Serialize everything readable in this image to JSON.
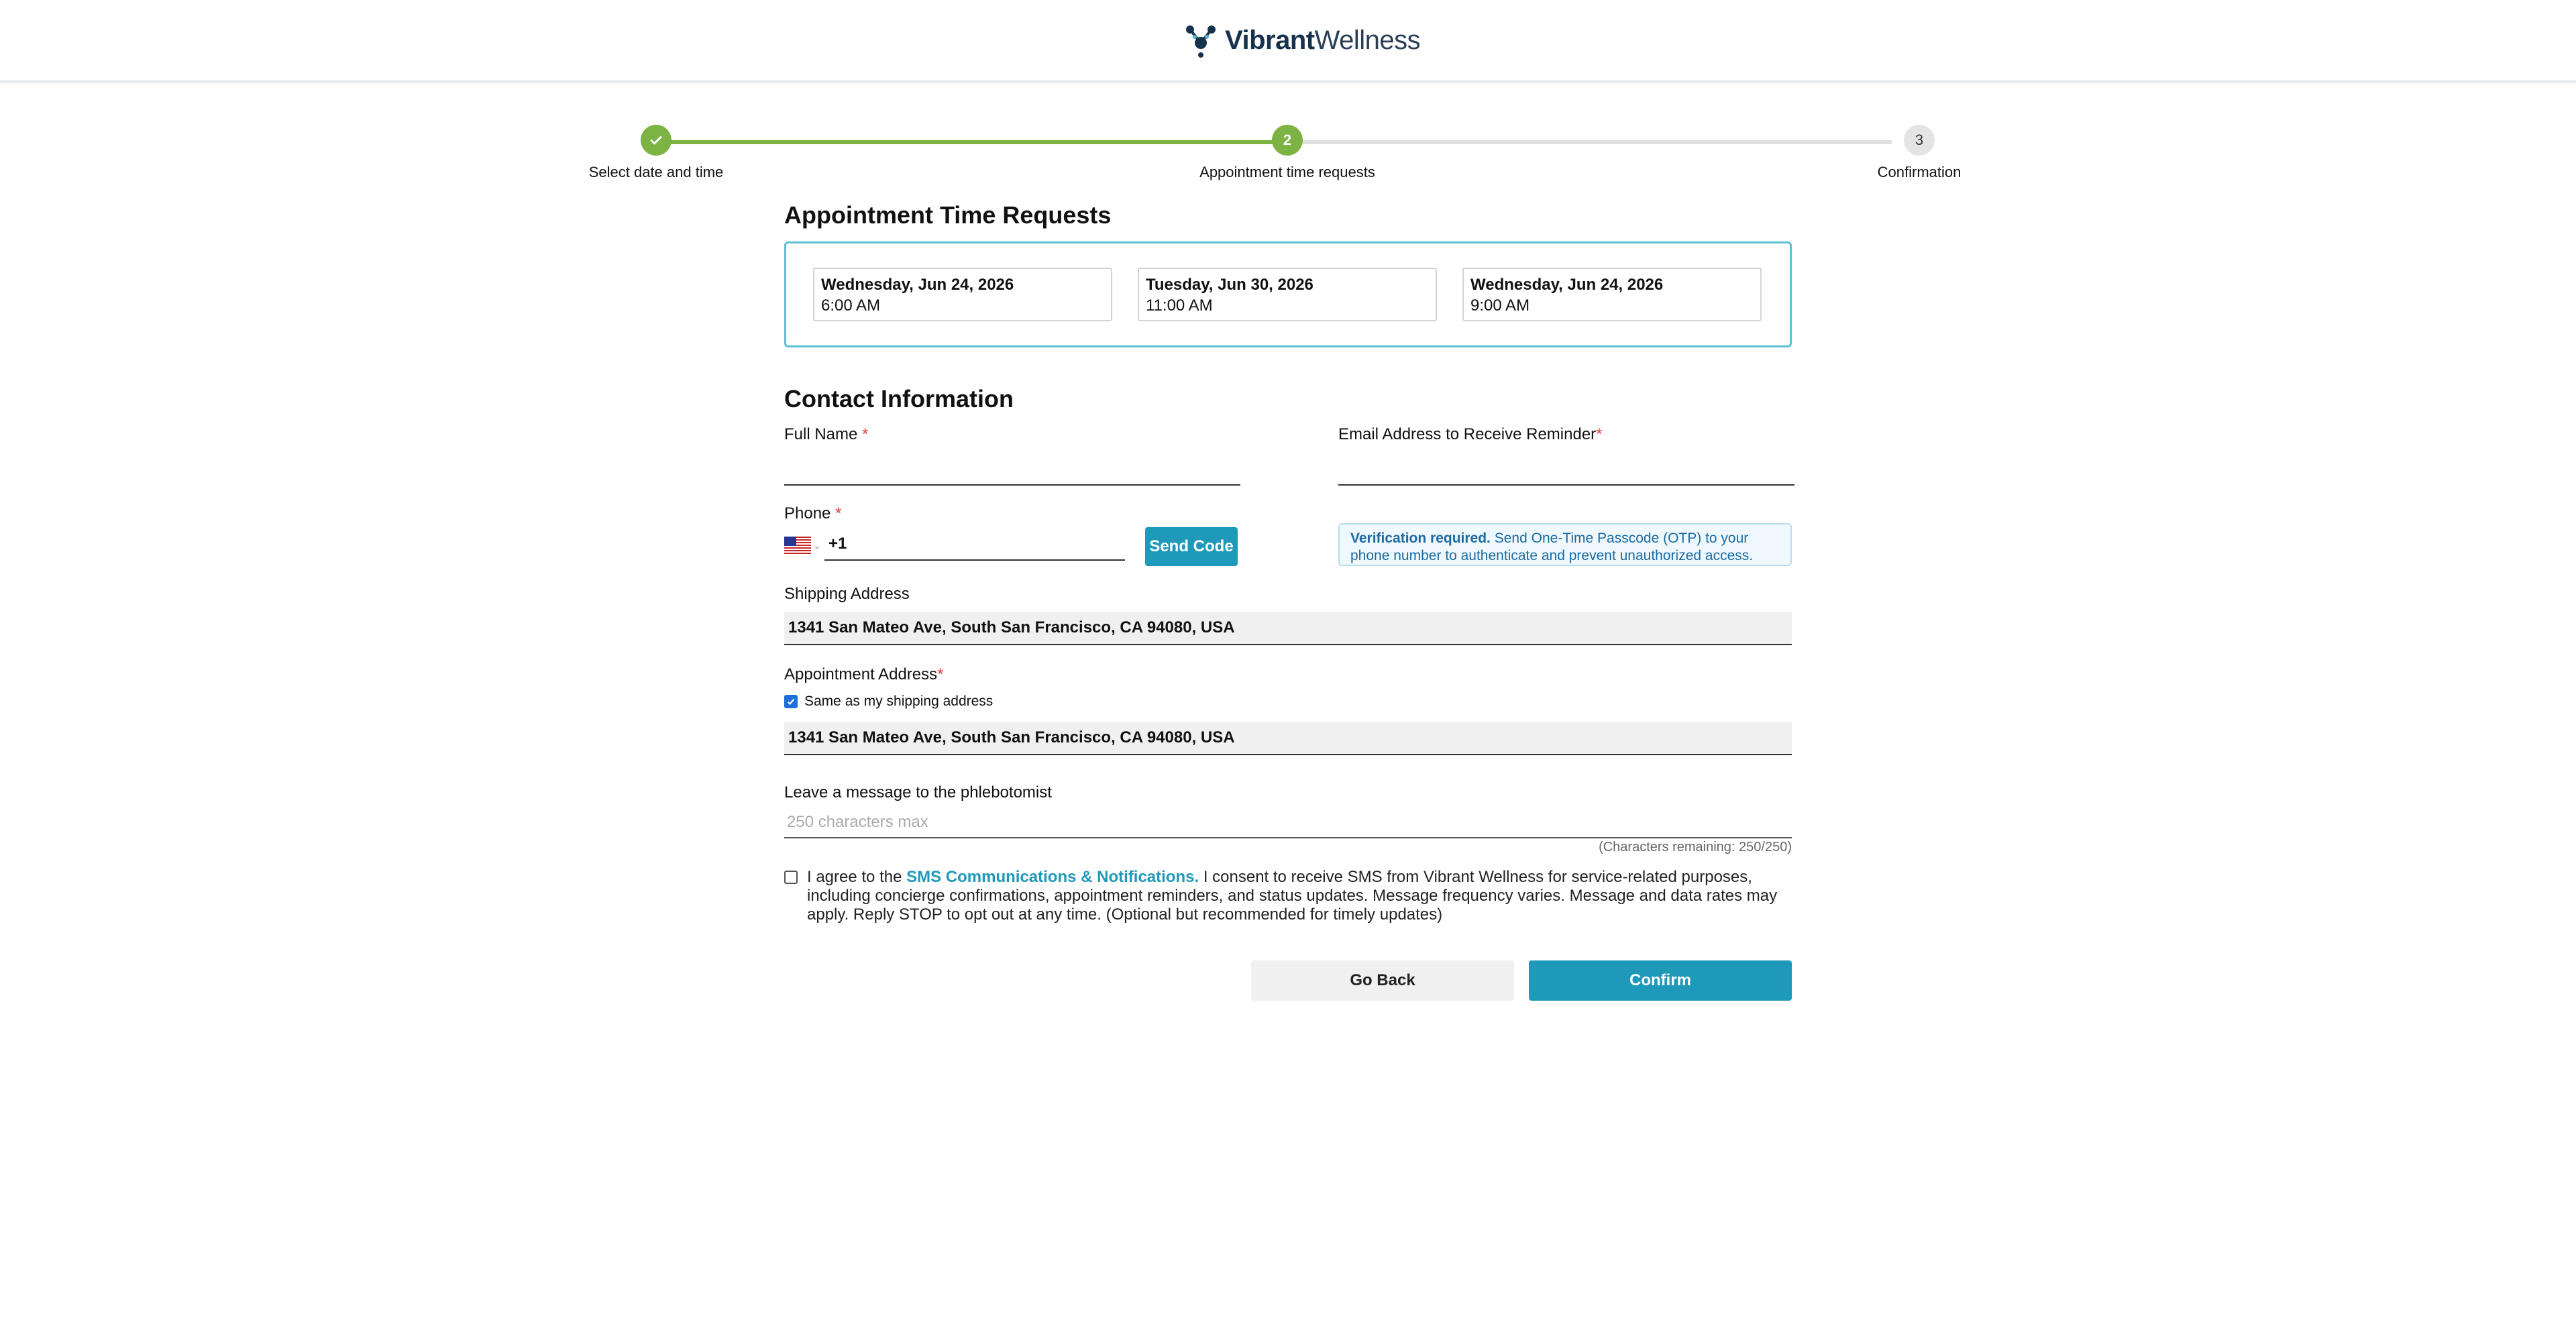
{
  "brand": {
    "name_bold": "Vibrant",
    "name_light": "Wellness"
  },
  "stepper": {
    "steps": [
      {
        "number": "1",
        "label": "Select date and time",
        "status": "complete"
      },
      {
        "number": "2",
        "label": "Appointment time requests",
        "status": "current"
      },
      {
        "number": "3",
        "label": "Confirmation",
        "status": "upcoming"
      }
    ]
  },
  "requests": {
    "title": "Appointment Time Requests",
    "items": [
      {
        "date": "Wednesday, Jun 24, 2026",
        "time": "6:00 AM"
      },
      {
        "date": "Tuesday, Jun 30, 2026",
        "time": "11:00 AM"
      },
      {
        "date": "Wednesday, Jun 24, 2026",
        "time": "9:00 AM"
      }
    ]
  },
  "contact": {
    "title": "Contact Information",
    "full_name_label": "Full Name",
    "full_name_value": "",
    "email_label": "Email Address to Receive Reminder",
    "email_value": "",
    "phone_label": "Phone",
    "phone_prefix": "+1",
    "phone_value": "",
    "send_code": "Send Code",
    "verify_bold": "Verification required.",
    "verify_text": "Send One-Time Passcode (OTP) to your phone number to authenticate and prevent unauthorized access.",
    "shipping_label": "Shipping Address",
    "shipping_value": "1341 San Mateo Ave, South San Francisco, CA 94080, USA",
    "appointment_label": "Appointment Address",
    "same_as_label": "Same as my shipping address",
    "same_as_checked": true,
    "appointment_value": "1341 San Mateo Ave, South San Francisco, CA 94080, USA",
    "message_label": "Leave a message to the phlebotomist",
    "message_placeholder": "250 characters max",
    "remaining": "(Characters remaining: 250/250)"
  },
  "consent": {
    "prefix": "I agree to the",
    "link": "SMS Communications & Notifications.",
    "text": "I consent to receive SMS from Vibrant Wellness for service-related purposes, including concierge confirmations, appointment reminders, and status updates. Message frequency varies. Message and data rates may apply. Reply STOP to opt out at any time. (Optional but recommended for timely updates)",
    "checked": false
  },
  "actions": {
    "back": "Go Back",
    "confirm": "Confirm"
  },
  "colors": {
    "accent": "#1f99b9",
    "progress": "#7cb342",
    "required": "#e53935"
  }
}
